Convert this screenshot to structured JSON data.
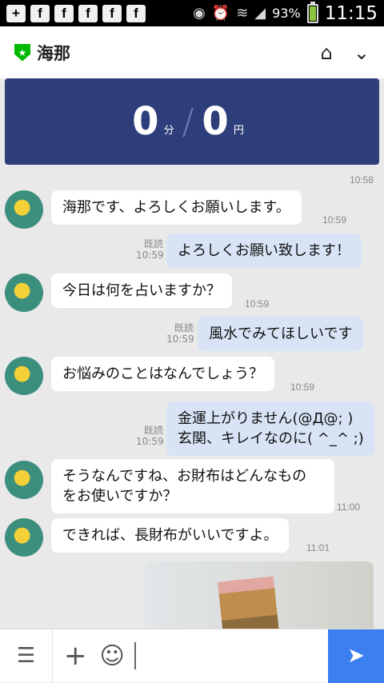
{
  "status_bar": {
    "notif_icons": [
      "+",
      "f",
      "f",
      "f",
      "f",
      "f"
    ],
    "battery_pct": "93%",
    "clock": "11:15",
    "icons": [
      "eye-icon",
      "alarm-icon",
      "wifi-icon",
      "signal-icon",
      "battery-icon"
    ]
  },
  "header": {
    "title": "海那",
    "home_icon": "home-icon",
    "menu_icon": "chevron-down-icon"
  },
  "banner": {
    "minutes": "0",
    "minutes_unit": "分",
    "yen": "0",
    "yen_unit": "円"
  },
  "chat": {
    "top_time": "10:58",
    "messages": [
      {
        "side": "other",
        "text": "海那です、よろしくお願いします。",
        "time": "10:59"
      },
      {
        "side": "me",
        "text": "よろしくお願い致します！",
        "read": "既読",
        "time": "10:59"
      },
      {
        "side": "other",
        "text": "今日は何を占いますか？",
        "time": "10:59"
      },
      {
        "side": "me",
        "text": "風水でみてほしいです",
        "read": "既読",
        "time": "10:59"
      },
      {
        "side": "other",
        "text": "お悩みのことはなんでしょう？",
        "time": "10:59"
      },
      {
        "side": "me",
        "line1": "金運上がりません(@Д@; )",
        "line2": "玄関、キレイなのに( ^_^ ;)",
        "read": "既読",
        "time": "10:59"
      },
      {
        "side": "other",
        "line1": "そうなんですね、お財布はどんなもの",
        "line2": "をお使いですか？",
        "time": "11:00"
      },
      {
        "side": "other",
        "text": "できれば、長財布がいいですよ。",
        "time": "11:01"
      }
    ]
  },
  "input": {
    "placeholder": ""
  }
}
